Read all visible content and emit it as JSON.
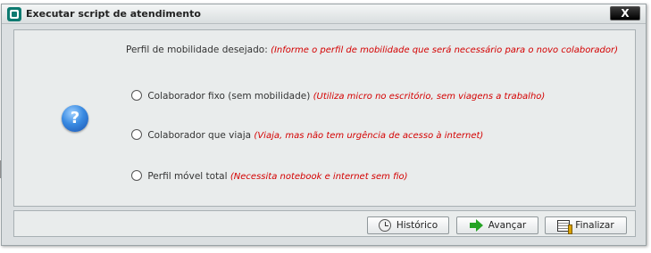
{
  "window": {
    "title": "Executar script de atendimento",
    "close_label": "X"
  },
  "question": {
    "label": "Perfil de mobilidade desejado:",
    "hint": "(Informe o perfil de mobilidade que será necessário para o novo colaborador)"
  },
  "options": [
    {
      "label": "Colaborador fixo (sem mobilidade)",
      "hint": "(Utiliza micro no escritório, sem viagens a trabalho)",
      "selected": false
    },
    {
      "label": "Colaborador que viaja",
      "hint": "(Viaja, mas não tem urgência de acesso à internet)",
      "selected": false
    },
    {
      "label": "Perfil móvel total",
      "hint": "(Necessita notebook e internet sem fio)",
      "selected": false
    }
  ],
  "help_icon_glyph": "?",
  "buttons": {
    "history": "Histórico",
    "next": "Avançar",
    "finish": "Finalizar"
  },
  "colors": {
    "hint_red": "#d40000",
    "arrow_green": "#25a325",
    "help_blue": "#3a8be2"
  },
  "icons": [
    "app-logo-icon",
    "close-icon",
    "help-icon",
    "history-icon",
    "next-arrow-icon",
    "finish-icon"
  ]
}
